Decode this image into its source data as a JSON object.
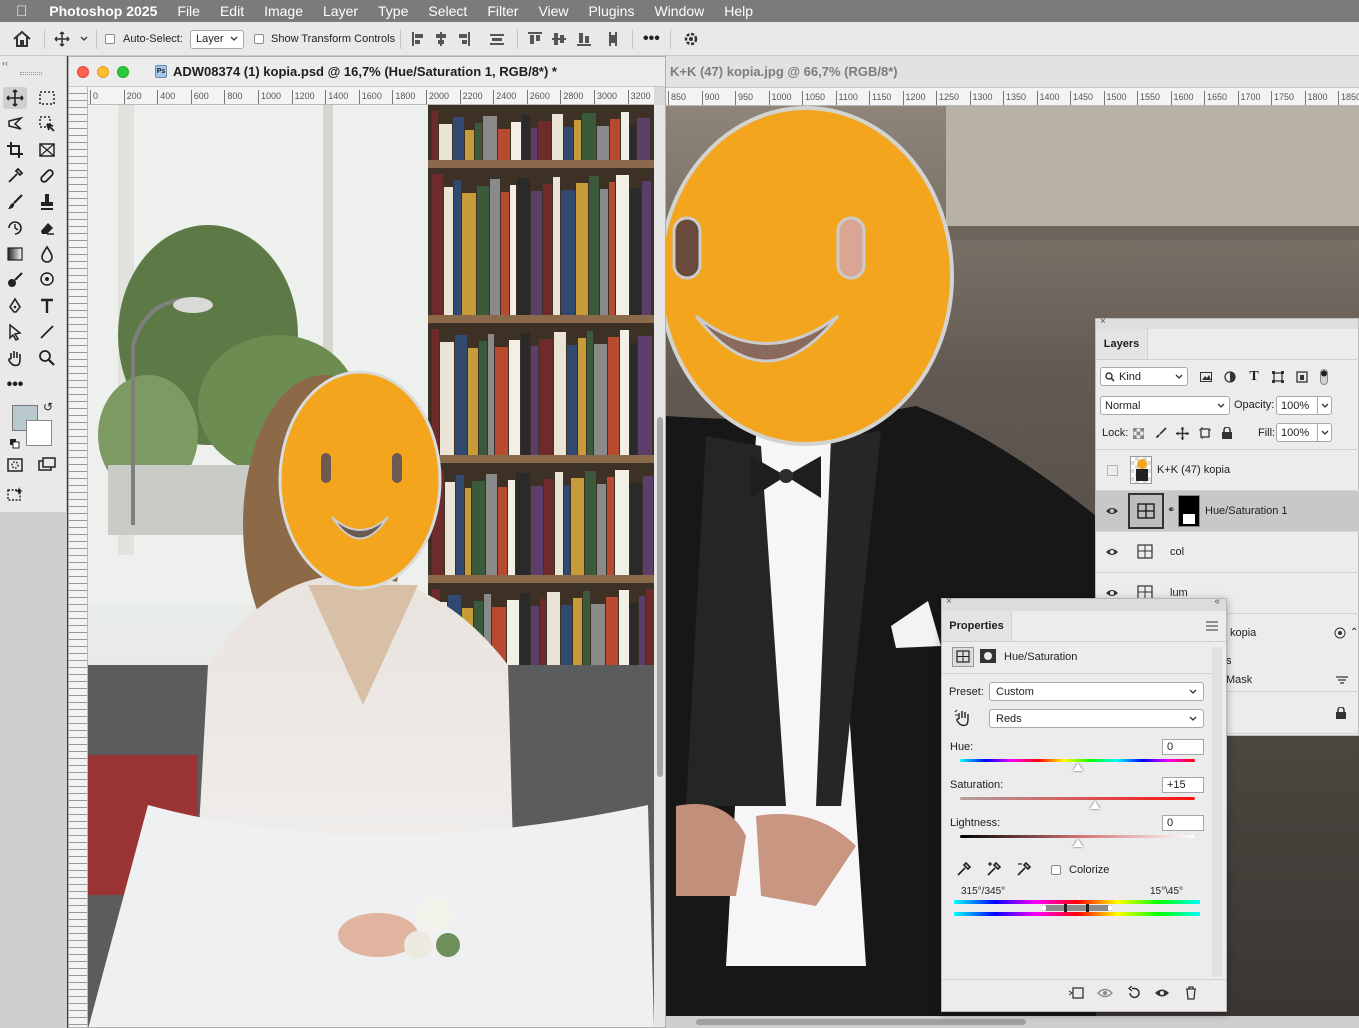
{
  "menubar": {
    "app_name": "Photoshop 2025",
    "items": [
      "File",
      "Edit",
      "Image",
      "Layer",
      "Type",
      "Select",
      "Filter",
      "View",
      "Plugins",
      "Window",
      "Help"
    ]
  },
  "options": {
    "auto_select_label": "Auto-Select:",
    "auto_select_target": "Layer",
    "transform_label": "Show Transform Controls"
  },
  "doc1": {
    "title": "ADW08374 (1) kopia.psd @ 16,7% (Hue/Saturation 1, RGB/8*) *",
    "ruler_ticks": [
      "0",
      "200",
      "400",
      "600",
      "800",
      "1000",
      "1200",
      "1400",
      "1600",
      "1800",
      "2000",
      "2200",
      "2400",
      "2600",
      "2800",
      "3000",
      "3200"
    ]
  },
  "doc2": {
    "title": "K+K (47) kopia.jpg @ 66,7% (RGB/8*)",
    "ruler_ticks": [
      "850",
      "900",
      "950",
      "1000",
      "1050",
      "1100",
      "1150",
      "1200",
      "1250",
      "1300",
      "1350",
      "1400",
      "1450",
      "1500",
      "1550",
      "1600",
      "1650",
      "1700",
      "1750",
      "1800",
      "1850"
    ]
  },
  "layers": {
    "tab": "Layers",
    "kind_filter": "Kind",
    "blend_mode": "Normal",
    "opacity_label": "Opacity:",
    "opacity": "100%",
    "lock_label": "Lock:",
    "fill_label": "Fill:",
    "fill": "100%",
    "rows": [
      {
        "name": "K+K (47) kopia",
        "visible": false
      },
      {
        "name": "Hue/Saturation 1",
        "visible": true,
        "selected": true
      },
      {
        "name": "col",
        "visible": true
      },
      {
        "name": "lum",
        "visible": true
      }
    ],
    "partial_row": {
      "name": "kopia",
      "fx_line": "s",
      "mask_line": "Mask"
    }
  },
  "properties": {
    "tab": "Properties",
    "adjustment": "Hue/Saturation",
    "preset_label": "Preset:",
    "preset": "Custom",
    "channel": "Reds",
    "hue_label": "Hue:",
    "hue": "0",
    "saturation_label": "Saturation:",
    "saturation": "+15",
    "lightness_label": "Lightness:",
    "lightness": "0",
    "colorize_label": "Colorize",
    "range_left": "315°/345°",
    "range_right": "15°\\45°"
  },
  "colors": {
    "accent_orange": "#F4A51E",
    "foreground_swatch": "#b8c8cc",
    "background_swatch": "#ffffff",
    "selected_row": "#c8c8c8"
  }
}
